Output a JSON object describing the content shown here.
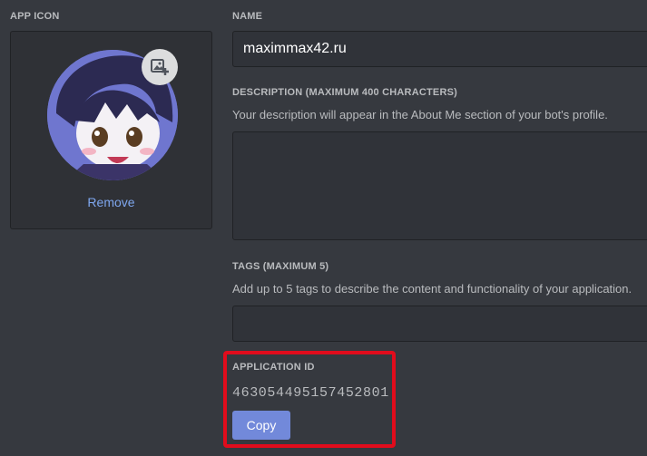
{
  "app_icon": {
    "label": "APP ICON",
    "remove_label": "Remove",
    "add_icon": "add-photo-icon"
  },
  "name": {
    "label": "NAME",
    "value": "maximmax42.ru"
  },
  "description": {
    "label": "DESCRIPTION (MAXIMUM 400 CHARACTERS)",
    "help": "Your description will appear in the About Me section of your bot's profile.",
    "value": ""
  },
  "tags": {
    "label": "TAGS (MAXIMUM 5)",
    "help": "Add up to 5 tags to describe the content and functionality of your application.",
    "value": ""
  },
  "application_id": {
    "label": "APPLICATION ID",
    "value": "463054495157452801",
    "copy_label": "Copy"
  },
  "colors": {
    "background": "#36393f",
    "input_background": "#303339",
    "link": "#7ea6ee",
    "button": "#7289da",
    "highlight": "#e10c1c"
  }
}
